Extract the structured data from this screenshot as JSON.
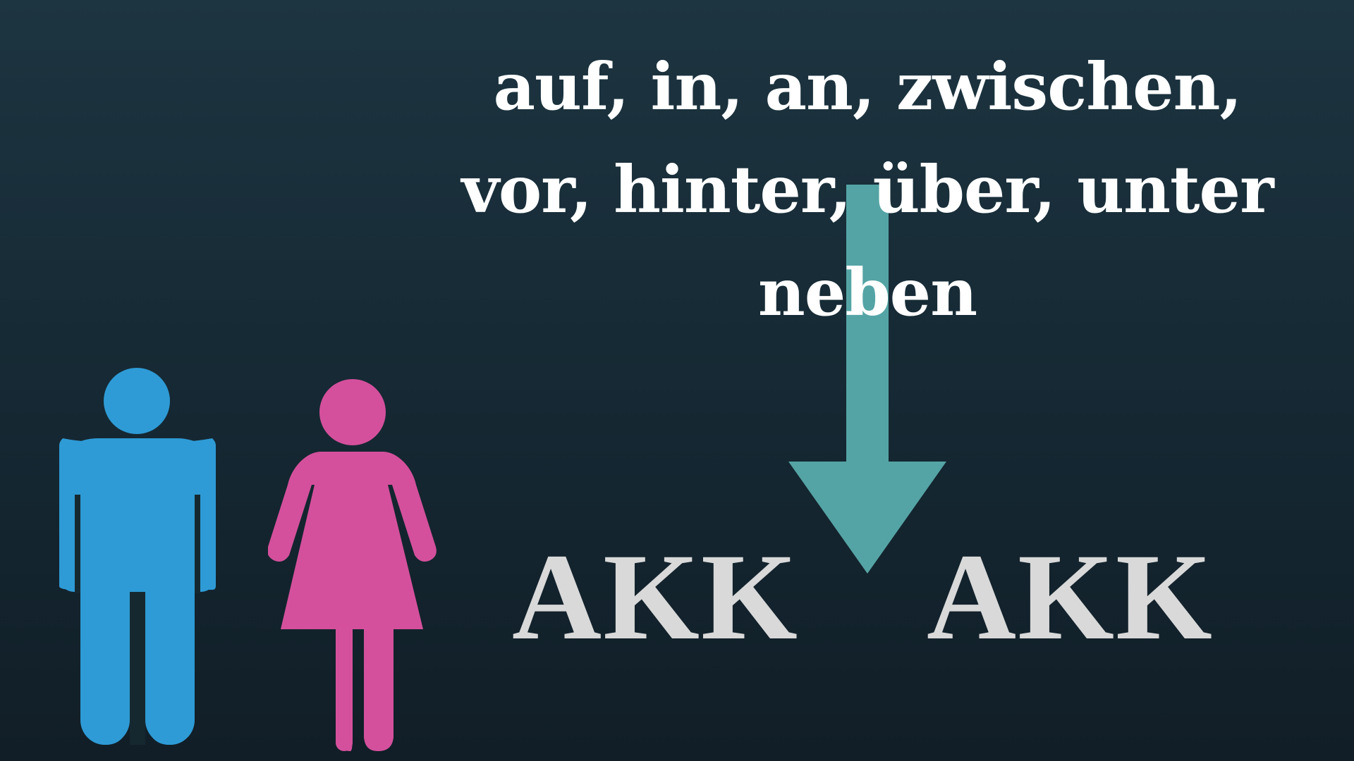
{
  "prepositions": {
    "line1": "auf, in, an, zwischen,",
    "line2": "vor, hinter, über, unter",
    "line3": "neben"
  },
  "case_labels": {
    "left": "AKK",
    "right": "AKK"
  },
  "icons": {
    "man": "man-icon",
    "woman": "woman-icon",
    "arrow": "arrow-down-icon"
  },
  "colors": {
    "background_top": "#1d3541",
    "background_bottom": "#111e27",
    "text": "#ffffff",
    "case_text": "#d9d9d9",
    "arrow": "#55a4a5",
    "man": "#2e9bd6",
    "woman": "#d4509c"
  }
}
